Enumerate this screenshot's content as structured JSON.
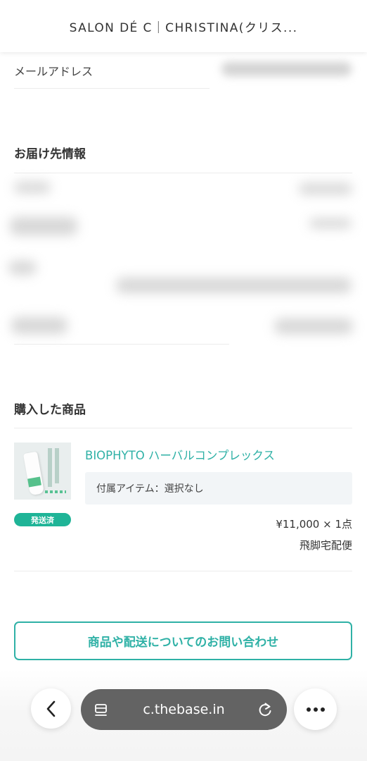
{
  "header": {
    "title": "SALON DÉ C｜CHRISTINA(クリス..."
  },
  "customer": {
    "email_label": "メールアドレス"
  },
  "shipping_section": {
    "title": "お届け先情報"
  },
  "purchased_section": {
    "title": "購入した商品",
    "item": {
      "name": "BIOPHYTO ハーバルコンプレックス",
      "option": "付属アイテム：選択なし",
      "status_badge": "発送済",
      "price_qty": "¥11,000 × 1点",
      "shipping_method": "飛脚宅配便"
    }
  },
  "contact_button": {
    "label": "商品や配送についてのお問い合わせ"
  },
  "browser": {
    "url": "c.thebase.in",
    "icons": {
      "back": "chevron-left-icon",
      "tabs": "tabs-icon",
      "reload": "reload-icon",
      "more": "more-dots-icon"
    }
  },
  "colors": {
    "accent": "#2fb1a6",
    "badge": "#1fb497",
    "url_bar": "#636363"
  }
}
